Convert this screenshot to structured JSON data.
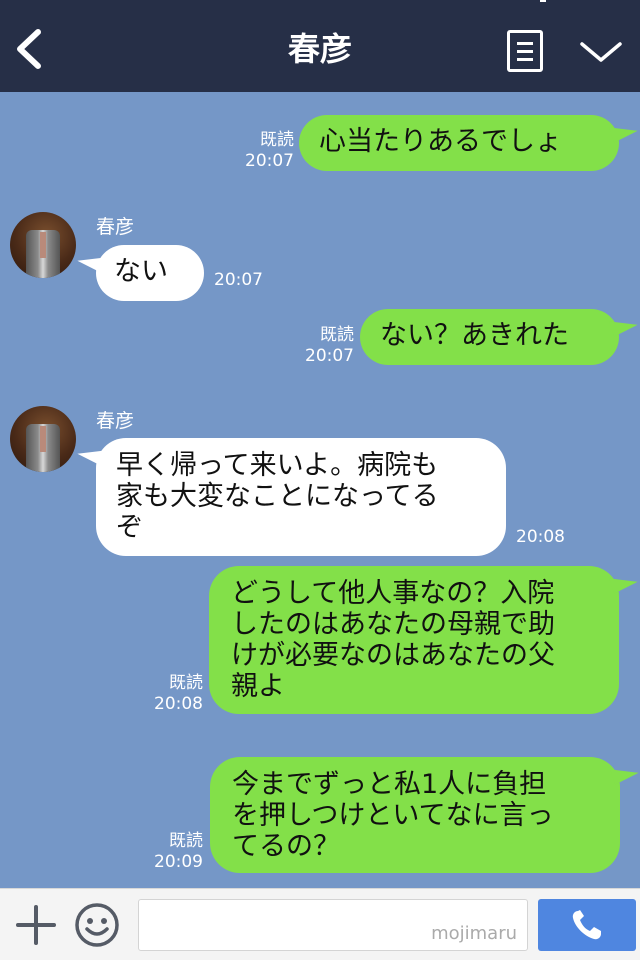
{
  "header": {
    "title": "春彦"
  },
  "messages": [
    {
      "side": "me",
      "read": "既読",
      "time": "20:07",
      "text": "心当たりあるでしょ"
    },
    {
      "side": "them",
      "sender": "春彦",
      "time": "20:07",
      "text": "ない"
    },
    {
      "side": "me",
      "read": "既読",
      "time": "20:07",
      "text": "ない？あきれた"
    },
    {
      "side": "them",
      "sender": "春彦",
      "time": "20:08",
      "lines": [
        "早く帰って来いよ。病院も",
        "家も大変なことになってる",
        "ぞ"
      ]
    },
    {
      "side": "me",
      "read": "既読",
      "time": "20:08",
      "lines": [
        "どうして他人事なの？入院",
        "したのはあなたの母親で助",
        "けが必要なのはあなたの父",
        "親よ"
      ]
    },
    {
      "side": "me",
      "read": "既読",
      "time": "20:09",
      "lines": [
        "今までずっと私1人に負担",
        "を押しつけといてなに言っ",
        "てるの？"
      ]
    }
  ],
  "footer": {
    "watermark": "mojimaru",
    "input_value": ""
  },
  "colors": {
    "background": "#7597c7",
    "header": "#262f47",
    "my_bubble": "#83e049",
    "their_bubble": "#ffffff",
    "send_button": "#4f86e0"
  }
}
